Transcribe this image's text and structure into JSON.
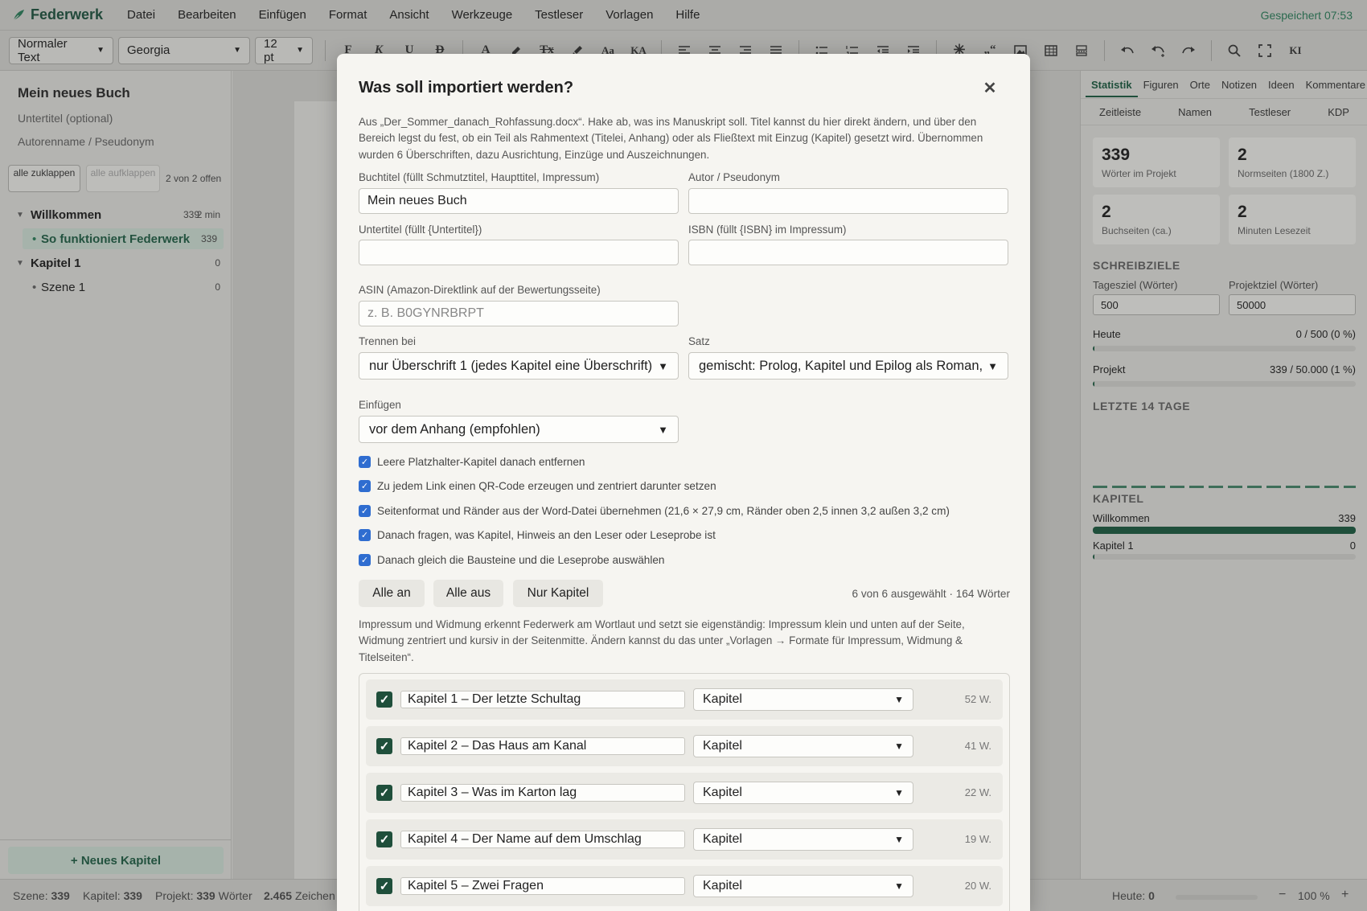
{
  "app": {
    "name": "Federwerk",
    "saved": "Gespeichert 07:53"
  },
  "menu": [
    "Datei",
    "Bearbeiten",
    "Einfügen",
    "Format",
    "Ansicht",
    "Werkzeuge",
    "Testleser",
    "Vorlagen",
    "Hilfe"
  ],
  "toolbar": {
    "style": "Normaler Text",
    "font": "Georgia",
    "size": "12 pt",
    "buttons": [
      "F",
      "K",
      "U",
      "D",
      "A",
      "Tx",
      "Aa",
      "KA",
      "„“",
      "KI"
    ]
  },
  "sidebar": {
    "title": "Mein neues Buch",
    "subtitle_placeholder": "Untertitel (optional)",
    "author_placeholder": "Autorenname / Pseudonym",
    "collapse_all": "alle zuklappen",
    "expand_all": "alle aufklappen",
    "open_count": "2 von 2 offen",
    "tree": [
      {
        "label": "Willkommen",
        "count": "339",
        "time": "2 min"
      },
      {
        "label": "So funktioniert Federwerk",
        "count": "339"
      },
      {
        "label": "Kapitel 1",
        "count": "0"
      },
      {
        "label": "Szene 1",
        "count": "0"
      }
    ],
    "new_chapter": "+ Neues Kapitel"
  },
  "right_panel": {
    "tabs": [
      "Statistik",
      "Figuren",
      "Orte",
      "Notizen",
      "Ideen",
      "Kommentare"
    ],
    "tabs2": [
      "Zeitleiste",
      "Namen",
      "Testleser",
      "KDP"
    ],
    "stats": [
      {
        "value": "339",
        "label": "Wörter im Projekt"
      },
      {
        "value": "2",
        "label": "Normseiten (1800 Z.)"
      },
      {
        "value": "2",
        "label": "Buchseiten (ca.)"
      },
      {
        "value": "2",
        "label": "Minuten Lesezeit"
      }
    ],
    "goals_heading": "SCHREIBZIELE",
    "daily_goal_label": "Tagesziel (Wörter)",
    "daily_goal_value": "500",
    "project_goal_label": "Projektziel (Wörter)",
    "project_goal_value": "50000",
    "today_label": "Heute",
    "today_value": "0 / 500 (0 %)",
    "today_progress": 0.0,
    "project_label": "Projekt",
    "project_value": "339 / 50.000 (1 %)",
    "project_progress": 0.007,
    "last14_heading": "LETZTE 14 TAGE",
    "chapters_heading": "KAPITEL",
    "chapters": [
      {
        "name": "Willkommen",
        "words": "339",
        "progress": 1.0
      },
      {
        "name": "Kapitel 1",
        "words": "0",
        "progress": 0.0
      }
    ]
  },
  "statusbar": {
    "scene_label": "Szene:",
    "scene_value": "339",
    "chapter_label": "Kapitel:",
    "chapter_value": "339",
    "project_label": "Projekt:",
    "project_value": "339",
    "project_unit": "Wörter",
    "chars_value": "2.465",
    "chars_unit": "Zeichen",
    "today_label": "Heute:",
    "today_value": "0",
    "zoom": "100 %",
    "zoom_minus": "−",
    "zoom_plus": "+"
  },
  "modal": {
    "title": "Was soll importiert werden?",
    "description": "Aus „Der_Sommer_danach_Rohfassung.docx“. Hake ab, was ins Manuskript soll. Titel kannst du hier direkt ändern, und über den Bereich legst du fest, ob ein Teil als Rahmentext (Titelei, Anhang) oder als Fließtext mit Einzug (Kapitel) gesetzt wird. Übernommen wurden 6 Überschriften, dazu Ausrichtung, Einzüge und Auszeichnungen.",
    "book_title_label": "Buchtitel (füllt Schmutztitel, Haupttitel, Impressum)",
    "book_title_value": "Mein neues Buch",
    "author_label": "Autor / Pseudonym",
    "author_value": "",
    "subtitle_label": "Untertitel (füllt {Untertitel})",
    "subtitle_value": "",
    "isbn_label": "ISBN (füllt {ISBN} im Impressum)",
    "isbn_value": "",
    "asin_label": "ASIN (Amazon-Direktlink auf der Bewertungsseite)",
    "asin_placeholder": "z. B. B0GYNRBRPT",
    "split_label": "Trennen bei",
    "split_value": "nur Überschrift 1 (jedes Kapitel eine Überschrift)",
    "typeset_label": "Satz",
    "typeset_value": "gemischt: Prolog, Kapitel und Epilog als Roman, al",
    "insert_label": "Einfügen",
    "insert_value": "vor dem Anhang (empfohlen)",
    "options": [
      "Leere Platzhalter-Kapitel danach entfernen",
      "Zu jedem Link einen QR-Code erzeugen und zentriert darunter setzen",
      "Seitenformat und Ränder aus der Word-Datei übernehmen (21,6 × 27,9 cm, Ränder oben 2,5 innen 3,2 außen 3,2 cm)",
      "Danach fragen, was Kapitel, Hinweis an den Leser oder Leseprobe ist",
      "Danach gleich die Bausteine und die Leseprobe auswählen"
    ],
    "all_on": "Alle an",
    "all_off": "Alle aus",
    "only_chapters": "Nur Kapitel",
    "selection_info": "6 von 6 ausgewählt · 164 Wörter",
    "note": "Impressum und Widmung erkennt Federwerk am Wortlaut und setzt sie eigenständig: Impressum klein und unten auf der Seite, Widmung zentriert und kursiv in der Seitenmitte. Ändern kannst du das unter „Vorlagen → Formate für Impressum, Widmung & Titelseiten“.",
    "items": [
      {
        "title": "Kapitel 1 – Der letzte Schultag",
        "type": "Kapitel",
        "words": "52 W."
      },
      {
        "title": "Kapitel 2 – Das Haus am Kanal",
        "type": "Kapitel",
        "words": "41 W."
      },
      {
        "title": "Kapitel 3 – Was im Karton lag",
        "type": "Kapitel",
        "words": "22 W."
      },
      {
        "title": "Kapitel 4 – Der Name auf dem Umschlag",
        "type": "Kapitel",
        "words": "19 W."
      },
      {
        "title": "Kapitel 5 – Zwei Fragen",
        "type": "Kapitel",
        "words": "20 W."
      }
    ]
  }
}
